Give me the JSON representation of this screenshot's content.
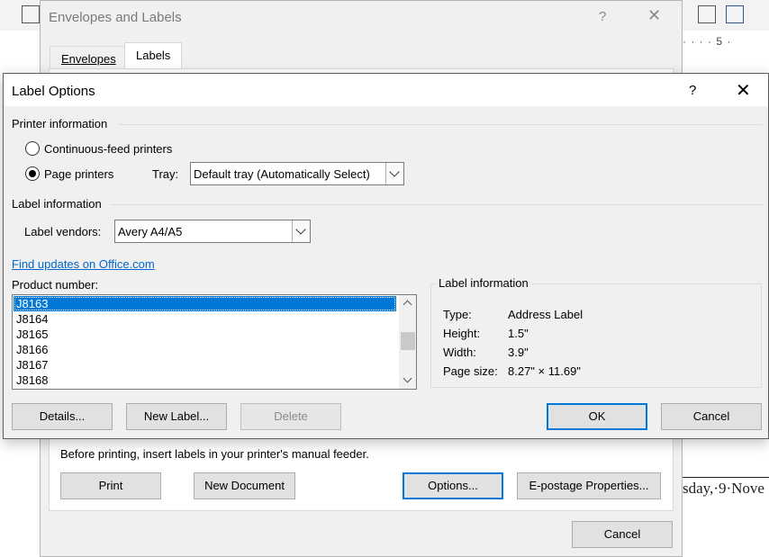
{
  "word": {
    "ruler_text": "·  ·  ·  ·  5  ·",
    "doc_text": "sday,·9·Nove"
  },
  "env_dialog": {
    "title": "Envelopes and Labels",
    "help_glyph": "?",
    "close_glyph": "✕",
    "tabs": [
      {
        "label": "Envelopes",
        "underline_index": 0
      },
      {
        "label": "Labels",
        "underline_index": 0
      }
    ],
    "note": "Before printing, insert labels in your printer's manual feeder.",
    "buttons": {
      "print": "Print",
      "new_document": "New Document",
      "options": "Options...",
      "epostage": "E-postage Properties...",
      "cancel": "Cancel"
    }
  },
  "label_options": {
    "title": "Label Options",
    "help_glyph": "?",
    "close_glyph": "✕",
    "printer_info_heading": "Printer information",
    "radio_continuous": "Continuous-feed printers",
    "radio_page": "Page printers",
    "selected_printer": "Page printers",
    "tray_label": "Tray:",
    "tray_value": "Default tray (Automatically Select)",
    "label_info_heading": "Label information",
    "vendors_label": "Label vendors:",
    "vendors_value": "Avery A4/A5",
    "find_updates_link": "Find updates on Office.com",
    "product_number_label": "Product number:",
    "products": [
      "J8163",
      "J8164",
      "J8165",
      "J8166",
      "J8167",
      "J8168"
    ],
    "selected_product": "J8163",
    "info_panel": {
      "heading": "Label information",
      "rows": [
        {
          "key": "Type:",
          "value": "Address Label"
        },
        {
          "key": "Height:",
          "value": "1.5\""
        },
        {
          "key": "Width:",
          "value": "3.9\""
        },
        {
          "key": "Page size:",
          "value": "8.27\" × 11.69\""
        }
      ]
    },
    "buttons": {
      "details": "Details...",
      "new_label": "New Label...",
      "delete": "Delete",
      "ok": "OK",
      "cancel": "Cancel"
    }
  },
  "colors": {
    "selection": "#0078d7",
    "link": "#0066cc",
    "dialog_bg": "#f0f0f0"
  }
}
